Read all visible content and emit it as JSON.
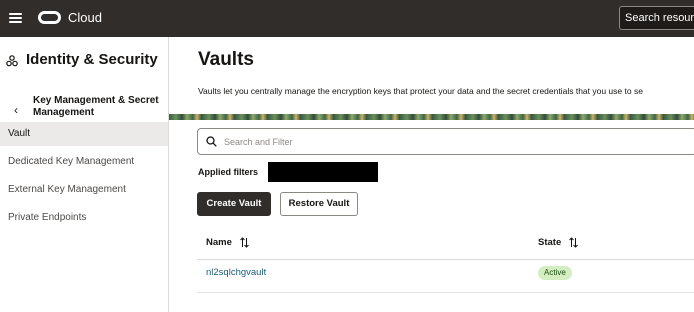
{
  "topbar": {
    "brand": "Cloud",
    "search_placeholder": "Search resources"
  },
  "sidebar": {
    "service_title": "Identity & Security",
    "section_title": "Key Management & Secret Management",
    "items": [
      {
        "label": "Vault",
        "active": true
      },
      {
        "label": "Dedicated Key Management",
        "active": false
      },
      {
        "label": "External Key Management",
        "active": false
      },
      {
        "label": "Private Endpoints",
        "active": false
      }
    ]
  },
  "main": {
    "title": "Vaults",
    "description": "Vaults let you centrally manage the encryption keys that protect your data and the secret credentials that you use to se",
    "filter_placeholder": "Search and Filter",
    "applied_filters_label": "Applied filters",
    "create_button": "Create Vault",
    "restore_button": "Restore Vault",
    "table": {
      "columns": [
        "Name",
        "State"
      ],
      "rows": [
        {
          "name": "nl2sqlchgvault",
          "state": "Active"
        }
      ]
    }
  },
  "colors": {
    "topbar": "#312d2a",
    "primary_button": "#312d2a",
    "link": "#1a5a7a",
    "active_badge_bg": "#d4edc1"
  }
}
